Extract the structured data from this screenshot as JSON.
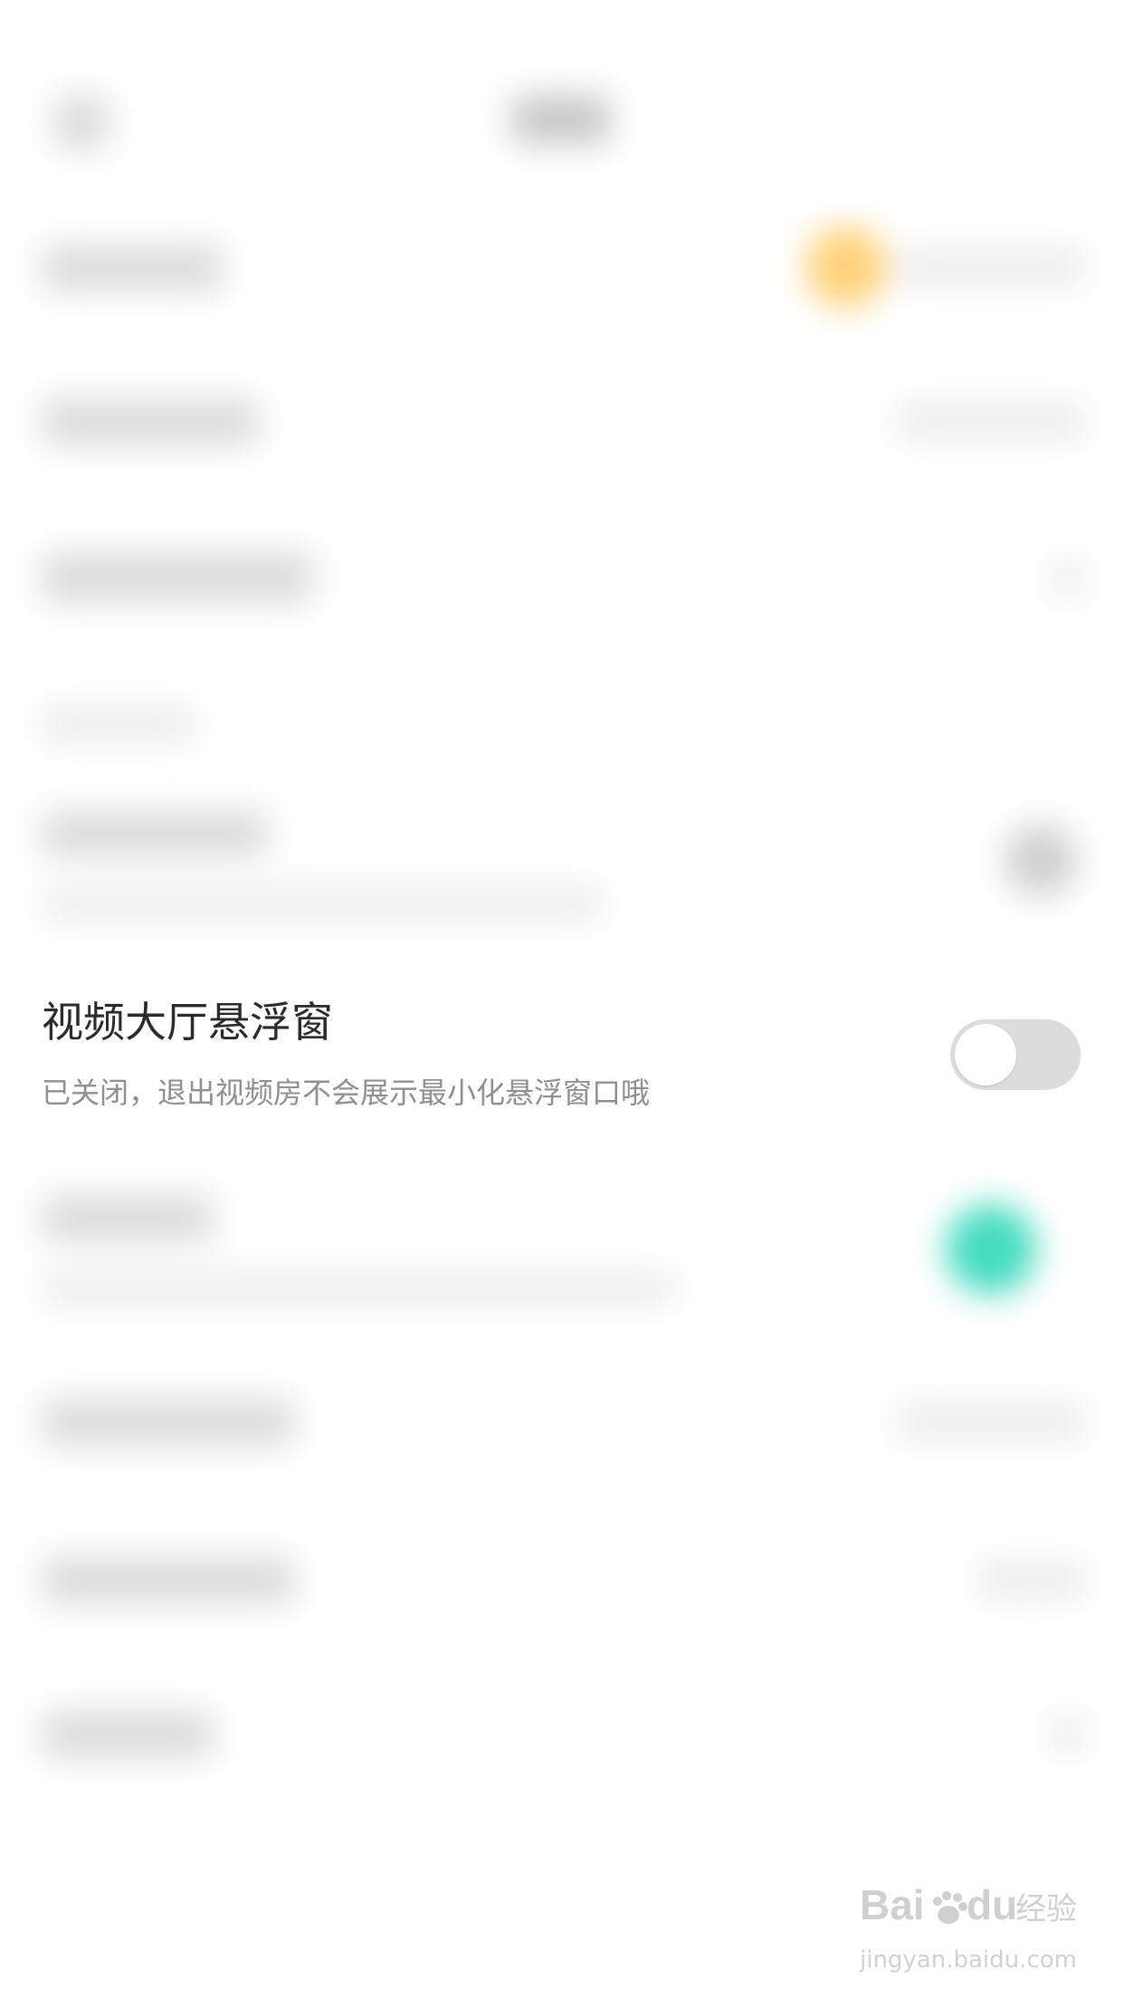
{
  "focused_setting": {
    "title": "视频大厅悬浮窗",
    "description": "已关闭，退出视频房不会展示最小化悬浮窗口哦",
    "toggle_state": "off"
  },
  "watermark": {
    "logo_text": "Baidu经验",
    "url": "jingyan.baidu.com"
  },
  "colors": {
    "toggle_off_track": "#dcdcdc",
    "toggle_knob": "#ffffff",
    "blurred_accent_orange": "#ffd27a",
    "blurred_accent_teal": "#44dcc0"
  }
}
